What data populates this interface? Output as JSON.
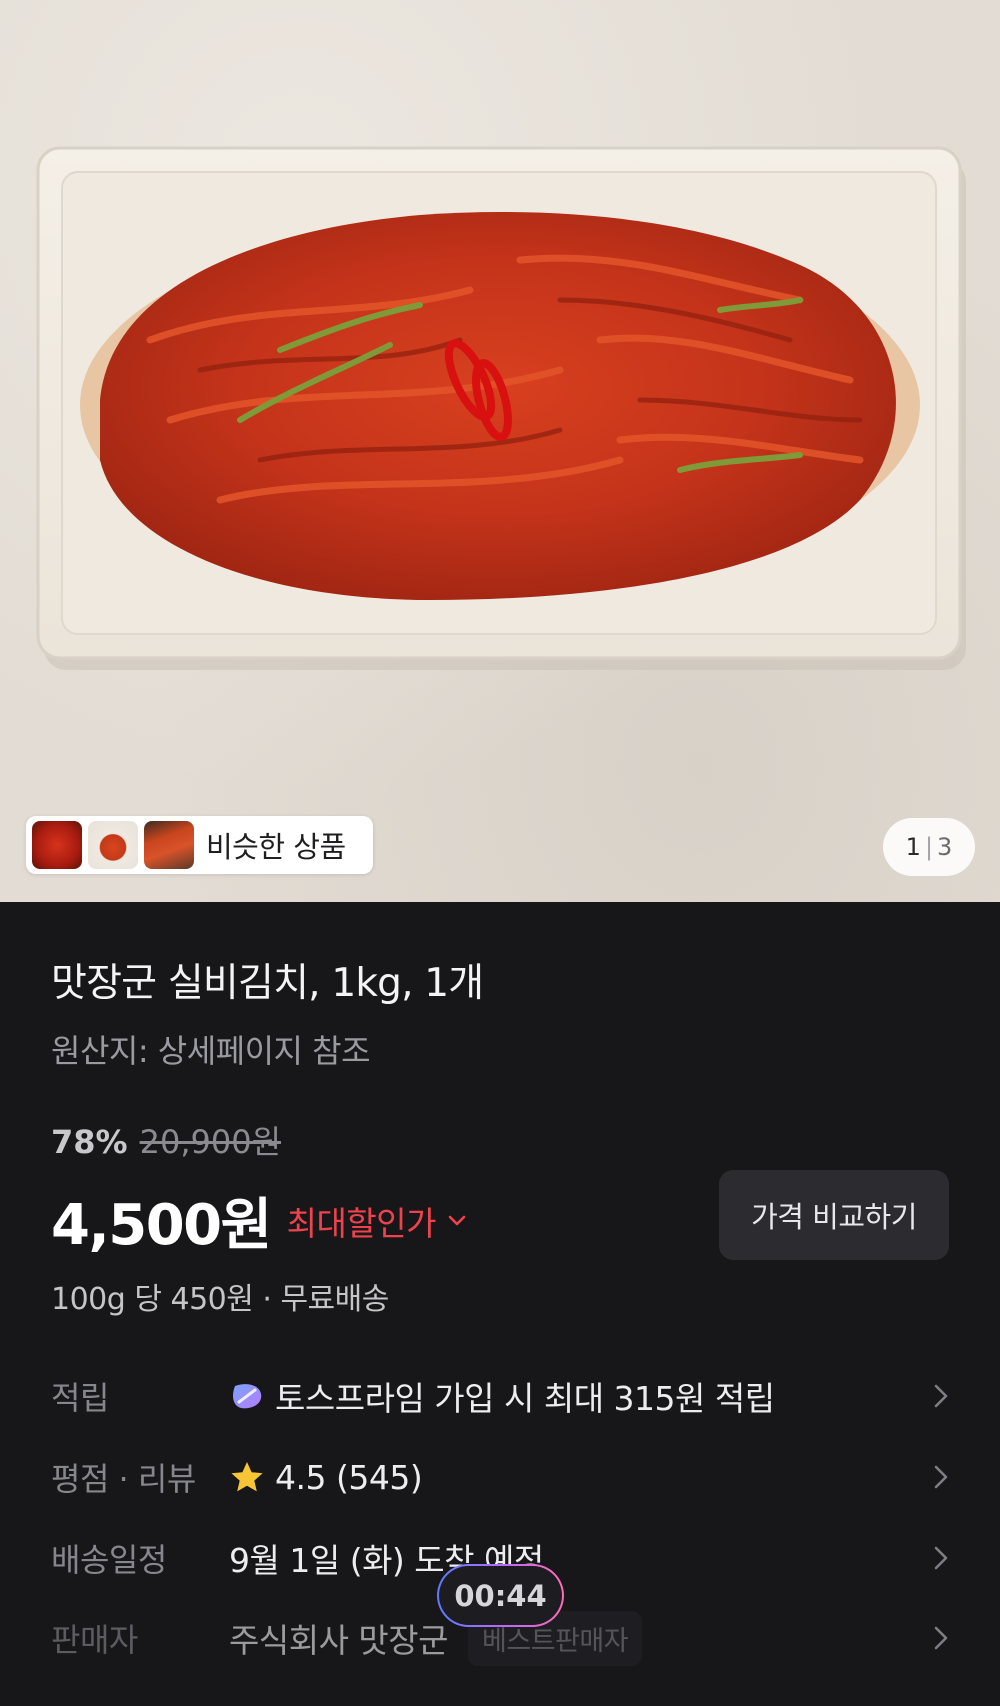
{
  "hero": {
    "similar_products_label": "비슷한 상품",
    "pager": {
      "current": "1",
      "separator": "|",
      "total": "3"
    }
  },
  "product": {
    "title": "맛장군 실비김치, 1kg, 1개",
    "origin": "원산지: 상세페이지 참조",
    "discount_rate": "78%",
    "original_price": "20,900원",
    "price": "4,500원",
    "best_price_label": "최대할인가",
    "compare_button": "가격 비교하기",
    "unit_price": "100g 당 450원 · 무료배송"
  },
  "details": [
    {
      "label": "적립",
      "value": "토스프라임 가입 시 최대 315원 적립",
      "icon": "prime-icon"
    },
    {
      "label": "평점 · 리뷰",
      "value": "4.5 (545)",
      "icon": "star-icon"
    },
    {
      "label": "배송일정",
      "value": "9월 1일 (화) 도착 예정",
      "icon": ""
    },
    {
      "label": "판매자",
      "value": "주식회사 맛장군",
      "badge": "베스트판매자",
      "icon": ""
    }
  ],
  "overlay": {
    "timer": "00:44"
  },
  "colors": {
    "background": "#17171a",
    "accent_red": "#f0424c",
    "star": "#f8c534",
    "button_bg": "#2b2b30"
  }
}
